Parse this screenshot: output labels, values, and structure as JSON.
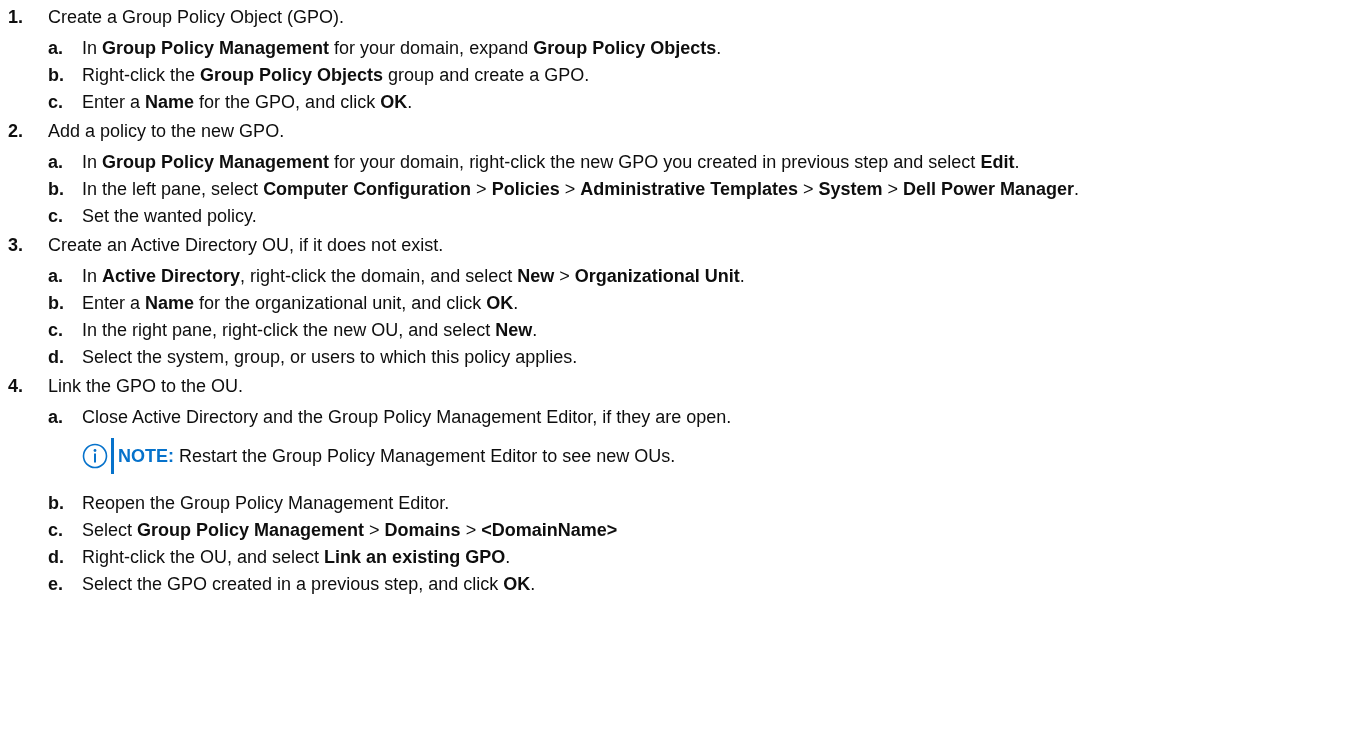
{
  "steps": [
    {
      "marker": "1.",
      "text": "Create a Group Policy Object (GPO).",
      "substeps": [
        {
          "marker": "a.",
          "text": "In **Group Policy Management** for your domain, expand **Group Policy Objects**."
        },
        {
          "marker": "b.",
          "text": "Right-click the **Group Policy Objects** group and create a GPO."
        },
        {
          "marker": "c.",
          "text": "Enter a **Name** for the GPO, and click **OK**."
        }
      ]
    },
    {
      "marker": "2.",
      "text": "Add a policy to the new GPO.",
      "substeps": [
        {
          "marker": "a.",
          "text": "In **Group Policy Management** for your domain, right-click the new GPO you created in previous step and select **Edit**."
        },
        {
          "marker": "b.",
          "text": "In the left pane, select **Computer Configuration** > **Policies** > **Administrative Templates** > **System** > **Dell Power Manager**."
        },
        {
          "marker": "c.",
          "text": "Set the wanted policy."
        }
      ]
    },
    {
      "marker": "3.",
      "text": "Create an Active Directory OU, if it does not exist.",
      "substeps": [
        {
          "marker": "a.",
          "text": "In **Active Directory**, right-click the domain, and select **New** > **Organizational Unit**."
        },
        {
          "marker": "b.",
          "text": "Enter a **Name** for the organizational unit, and click **OK**."
        },
        {
          "marker": "c.",
          "text": "In the right pane, right-click the new OU, and select **New**."
        },
        {
          "marker": "d.",
          "text": "Select the system, group, or users to which this policy applies."
        }
      ]
    },
    {
      "marker": "4.",
      "text": "Link the GPO to the OU.",
      "substeps": [
        {
          "marker": "a.",
          "text": "Close Active Directory and the Group Policy Management Editor, if they are open.",
          "note": {
            "label": "NOTE:",
            "text": "Restart the Group Policy Management Editor to see new OUs."
          }
        },
        {
          "marker": "b.",
          "text": "Reopen the Group Policy Management Editor."
        },
        {
          "marker": "c.",
          "text": "Select **Group Policy Management** > **Domains** > **<DomainName>**"
        },
        {
          "marker": "d.",
          "text": "Right-click the OU, and select **Link an existing GPO**."
        },
        {
          "marker": "e.",
          "text": "Select the GPO created in a previous step, and click **OK**."
        }
      ]
    }
  ]
}
